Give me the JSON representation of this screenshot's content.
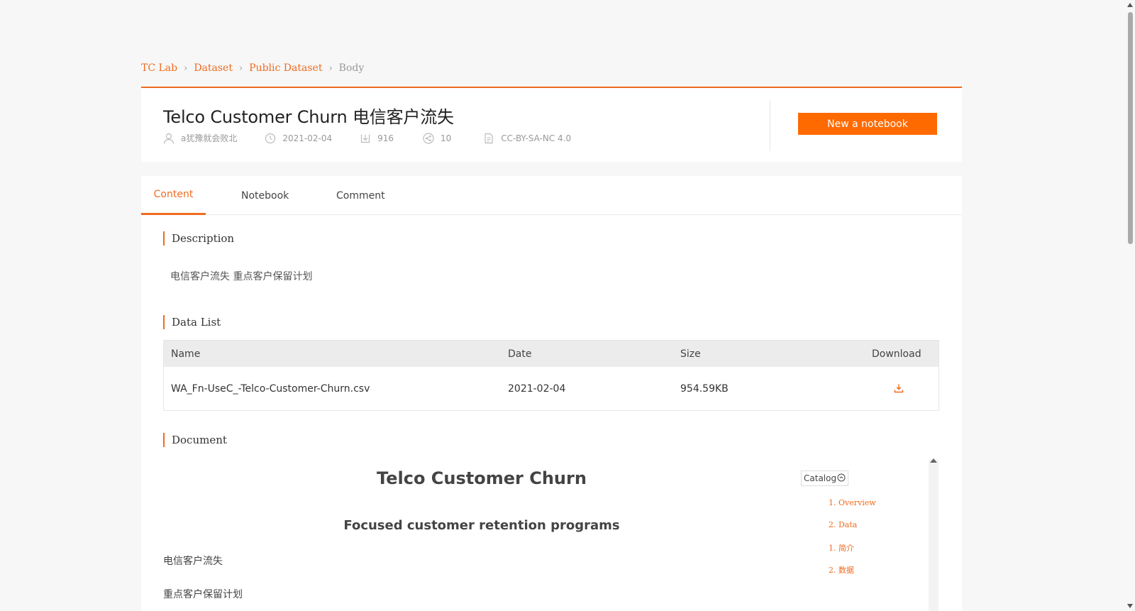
{
  "breadcrumb": {
    "items": [
      "TC Lab",
      "Dataset",
      "Public Dataset"
    ],
    "current": "Body"
  },
  "dataset": {
    "title": "Telco Customer Churn 电信客户流失",
    "author": "a犹豫就会败北",
    "date": "2021-02-04",
    "downloads": "916",
    "shares": "10",
    "license": "CC-BY-SA-NC 4.0",
    "new_notebook_label": "New a notebook"
  },
  "tabs": [
    {
      "label": "Content",
      "active": true
    },
    {
      "label": "Notebook",
      "active": false
    },
    {
      "label": "Comment",
      "active": false
    }
  ],
  "description": {
    "title": "Description",
    "text": "电信客户流失 重点客户保留计划"
  },
  "data_list": {
    "title": "Data List",
    "headers": [
      "Name",
      "Date",
      "Size",
      "Download"
    ],
    "rows": [
      {
        "name": "WA_Fn-UseC_-Telco-Customer-Churn.csv",
        "date": "2021-02-04",
        "size": "954.59KB",
        "download_icon": "download-icon"
      }
    ]
  },
  "document": {
    "title": "Document",
    "heading": "Telco Customer Churn",
    "subheading": "Focused customer retention programs",
    "paragraphs": [
      "电信客户流失",
      "重点客户保留计划"
    ],
    "catalog_label": "Catalog",
    "catalog": [
      "1. Overview",
      "2. Data",
      "1. 简介",
      "2. 数据"
    ]
  },
  "colors": {
    "accent": "#f06b1f",
    "button": "#ff6a00",
    "background": "#f7f7f7"
  }
}
